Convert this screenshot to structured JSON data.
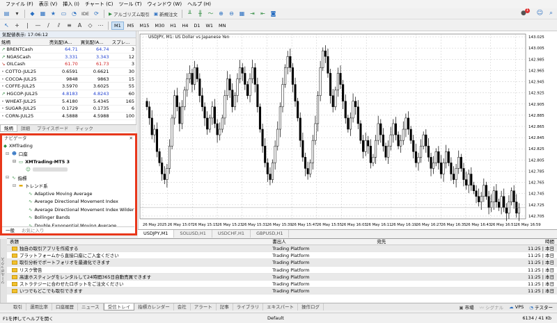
{
  "menu": [
    "ファイル (F)",
    "表示 (V)",
    "挿入 (I)",
    "チャート (C)",
    "ツール (T)",
    "ウィンドウ (W)",
    "ヘルプ (H)"
  ],
  "toolbar": {
    "ide": "IDE",
    "algo": "アルゴリズム取引",
    "new_order": "新規注文",
    "notification_count": "1"
  },
  "timeframes": [
    "M1",
    "M5",
    "M15",
    "M30",
    "H1",
    "H4",
    "D1",
    "W1",
    "MN"
  ],
  "active_timeframe": "M1",
  "market_watch": {
    "title": "気配値表示: 17:06:12",
    "columns": [
      "銘柄",
      "売気配(A...",
      "買気配(A...",
      "スプレ..."
    ],
    "rows": [
      {
        "dir": "up",
        "symbol": "BRENTCash",
        "bid": "64.71",
        "ask": "64.74",
        "spread": "3",
        "color": "blue"
      },
      {
        "dir": "up",
        "symbol": "NGASCash",
        "bid": "3.331",
        "ask": "3.343",
        "spread": "12",
        "color": "blue"
      },
      {
        "dir": "dn",
        "symbol": "OILCash",
        "bid": "61.70",
        "ask": "61.73",
        "spread": "3",
        "color": "red"
      },
      {
        "dir": "nt",
        "symbol": "COTTO-JUL25",
        "bid": "0.6591",
        "ask": "0.6621",
        "spread": "30",
        "color": ""
      },
      {
        "dir": "nt",
        "symbol": "COCOA-JUL25",
        "bid": "9848",
        "ask": "9863",
        "spread": "15",
        "color": ""
      },
      {
        "dir": "nt",
        "symbol": "COFFE-JUL25",
        "bid": "3.5970",
        "ask": "3.6025",
        "spread": "55",
        "color": ""
      },
      {
        "dir": "up",
        "symbol": "HGCOP-JUL25",
        "bid": "4.8183",
        "ask": "4.8243",
        "spread": "60",
        "color": "blue"
      },
      {
        "dir": "nt",
        "symbol": "WHEAT-JUL25",
        "bid": "5.4180",
        "ask": "5.4345",
        "spread": "165",
        "color": ""
      },
      {
        "dir": "nt",
        "symbol": "SUGAR-JUL25",
        "bid": "0.1729",
        "ask": "0.1735",
        "spread": "6",
        "color": ""
      },
      {
        "dir": "nt",
        "symbol": "CORN-JUL25",
        "bid": "4.5888",
        "ask": "4.5988",
        "spread": "100",
        "color": ""
      }
    ],
    "tabs": [
      "銘柄",
      "詳細",
      "プライスボード",
      "ティック"
    ]
  },
  "navigator": {
    "title": "ナビゲータ",
    "root": "XMTrading",
    "accounts_label": "口座",
    "server": "XMTrading-MT5 3",
    "indicators_label": "指標",
    "trend_folder": "トレンド系",
    "indicators": [
      "Adaptive Moving Average",
      "Average Directional Movement Index",
      "Average Directional Movement Index Wilder",
      "Bollinger Bands",
      "Double Exponential Moving Average"
    ],
    "tabs": [
      "一般",
      "お気に入り"
    ]
  },
  "chart_data": {
    "type": "candlestick",
    "title": "USDJPY, M1:  US Dollar vs Japanese Yen",
    "y_ticks": [
      "143.025",
      "143.005",
      "142.985",
      "142.965",
      "142.945",
      "142.925",
      "142.905",
      "142.885",
      "142.865",
      "142.845",
      "142.825",
      "142.805",
      "142.785",
      "142.765",
      "142.745",
      "142.725",
      "142.705"
    ],
    "x_ticks": [
      "26 May 2025",
      "26 May 15:07",
      "26 May 15:15",
      "26 May 15:23",
      "26 May 15:31",
      "26 May 15:39",
      "26 May 15:47",
      "26 May 15:55",
      "26 May 16:03",
      "26 May 16:11",
      "26 May 16:19",
      "26 May 16:27",
      "26 May 16:35",
      "26 May 16:43",
      "26 May 16:51",
      "26 May 16:59"
    ],
    "ylim": [
      142.7,
      143.03
    ],
    "grid": true,
    "up_color": "#000000",
    "down_color": "#000000",
    "close_path": [
      142.9,
      142.88,
      142.85,
      142.86,
      142.82,
      142.8,
      142.78,
      142.77,
      142.79,
      142.83,
      142.88,
      142.92,
      142.9,
      142.87,
      142.9,
      142.93,
      142.95,
      142.96,
      142.94,
      142.97,
      142.95,
      142.92,
      142.9,
      142.88,
      142.86,
      142.88,
      142.9,
      142.87,
      142.85,
      142.86,
      142.88,
      142.92,
      142.95,
      142.93,
      142.9,
      142.92,
      142.95,
      142.97,
      142.96,
      142.94,
      142.92,
      142.95,
      142.97,
      142.94,
      142.9,
      142.86,
      142.83,
      142.8,
      142.78,
      142.77,
      142.8,
      142.83,
      142.86,
      142.9,
      142.94,
      142.97,
      142.99,
      142.97,
      142.94,
      142.91,
      142.88,
      142.84,
      142.81,
      142.79,
      142.78,
      142.8,
      142.84,
      142.87,
      142.92,
      142.97,
      143.0,
      142.99,
      142.96,
      142.92,
      142.9,
      142.93,
      142.96,
      142.94,
      142.91,
      142.88,
      142.86,
      142.88,
      142.91,
      142.9,
      142.87,
      142.84,
      142.82,
      142.84,
      142.83,
      142.8,
      142.81,
      142.84,
      142.87,
      142.85,
      142.83,
      142.81,
      142.83,
      142.85,
      142.87,
      142.85,
      142.83,
      142.84,
      142.86,
      142.88,
      142.86,
      142.84,
      142.82,
      142.8,
      142.81,
      142.83,
      142.85,
      142.83,
      142.81,
      142.79,
      142.8,
      142.82,
      142.8,
      142.78,
      142.8,
      142.82,
      142.8,
      142.78,
      142.77,
      142.79,
      142.81,
      142.79,
      142.77,
      142.76,
      142.78,
      142.76,
      142.75,
      142.74,
      142.73,
      142.74,
      142.76,
      142.74,
      142.72,
      142.73,
      142.75,
      142.73,
      142.72,
      142.74,
      142.72,
      142.71,
      142.73,
      142.75,
      142.73,
      142.71,
      142.72
    ]
  },
  "chart_tabs": [
    "USDJPY,M1",
    "SOLUSD,H1",
    "USDCHF,H1",
    "GBPUSD,H1"
  ],
  "bottom_panel": {
    "columns": [
      "表題",
      "書出人",
      "宛先",
      "時間"
    ],
    "rows": [
      {
        "title": "独自の取引アプリを作成する",
        "from": "Trading Platform",
        "to": "",
        "time": "11:25 | 本日"
      },
      {
        "title": "プラットフォームから直接口座にご入金ください",
        "from": "Trading Platform",
        "to": "",
        "time": "11:25 | 本日"
      },
      {
        "title": "取引分析でポートフォリオを最適化できます",
        "from": "Trading Platform",
        "to": "",
        "time": "11:25 | 本日"
      },
      {
        "title": "リスク警告",
        "from": "Trading Platform",
        "to": "",
        "time": "11:25 | 本日"
      },
      {
        "title": "高速ホスティングをレンタルして24時間365日自動売買できます",
        "from": "Trading Platform",
        "to": "",
        "time": "11:25 | 本日"
      },
      {
        "title": "ストラテジーに合わせたロボットをご注文ください",
        "from": "Trading Platform",
        "to": "",
        "time": "11:25 | 本日"
      },
      {
        "title": "いつでもどこでも取引できます",
        "from": "Trading Platform",
        "to": "",
        "time": "11:25 | 本日"
      }
    ],
    "tabs": [
      "取引",
      "運用比率",
      "口座履歴",
      "ニュース",
      "受信トレイ",
      "指標カレンダー",
      "会社",
      "アラート",
      "記事",
      "ライブラリ",
      "エキスパート",
      "操作ログ"
    ],
    "active_tab": "受信トレイ",
    "right_items": [
      "市場",
      "シグナル",
      "VPS",
      "テスター"
    ],
    "toolbox_label": "ツールボックス"
  },
  "status": {
    "help": "F1を押してヘルプを開く",
    "profile": "Default",
    "traffic": "6134 / 41 Kb"
  }
}
